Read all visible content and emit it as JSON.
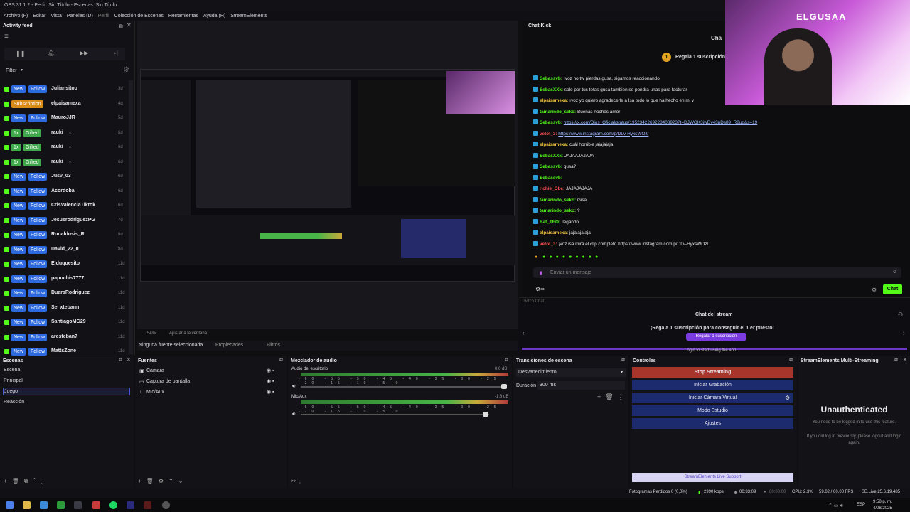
{
  "window": {
    "title": "OBS 31.1.2 - Perfil: Sin Título - Escenas: Sin Título"
  },
  "menu": [
    "Archivo (F)",
    "Editar",
    "Vista",
    "Paneles (D)",
    "Perfil",
    "Colección de Escenas",
    "Herramientas",
    "Ayuda (H)",
    "StreamElements"
  ],
  "activity": {
    "title": "Activity feed",
    "filter_label": "Filter",
    "rows": [
      {
        "badge": "New",
        "action": "Follow",
        "user": "Juliansitou",
        "age": "3d",
        "kind": "new"
      },
      {
        "badge": "Subscription",
        "action": "",
        "user": "elpaisamexa",
        "age": "4d",
        "kind": "sub"
      },
      {
        "badge": "New",
        "action": "Follow",
        "user": "MauroJJR",
        "age": "5d",
        "kind": "new"
      },
      {
        "badge": "1x",
        "action": "Gifted",
        "user": "rauki",
        "age": "6d",
        "kind": "gift"
      },
      {
        "badge": "1x",
        "action": "Gifted",
        "user": "rauki",
        "age": "6d",
        "kind": "gift"
      },
      {
        "badge": "1x",
        "action": "Gifted",
        "user": "rauki",
        "age": "6d",
        "kind": "gift"
      },
      {
        "badge": "New",
        "action": "Follow",
        "user": "Jusv_03",
        "age": "6d",
        "kind": "new"
      },
      {
        "badge": "New",
        "action": "Follow",
        "user": "Acordoba",
        "age": "6d",
        "kind": "new"
      },
      {
        "badge": "New",
        "action": "Follow",
        "user": "CrisValenciaTiktok",
        "age": "6d",
        "kind": "new"
      },
      {
        "badge": "New",
        "action": "Follow",
        "user": "JesusrodriguezPG",
        "age": "7d",
        "kind": "new"
      },
      {
        "badge": "New",
        "action": "Follow",
        "user": "Ronaldosis_R",
        "age": "8d",
        "kind": "new"
      },
      {
        "badge": "New",
        "action": "Follow",
        "user": "David_22_0",
        "age": "8d",
        "kind": "new"
      },
      {
        "badge": "New",
        "action": "Follow",
        "user": "Elduquesito",
        "age": "11d",
        "kind": "new"
      },
      {
        "badge": "New",
        "action": "Follow",
        "user": "papuchis7777",
        "age": "11d",
        "kind": "new"
      },
      {
        "badge": "New",
        "action": "Follow",
        "user": "DuarsRodriguez",
        "age": "11d",
        "kind": "new"
      },
      {
        "badge": "New",
        "action": "Follow",
        "user": "Se_xtebann",
        "age": "11d",
        "kind": "new"
      },
      {
        "badge": "New",
        "action": "Follow",
        "user": "SantiagoMG29",
        "age": "11d",
        "kind": "new"
      },
      {
        "badge": "New",
        "action": "Follow",
        "user": "aresteban7",
        "age": "11d",
        "kind": "new"
      },
      {
        "badge": "New",
        "action": "Follow",
        "user": "MattsZone",
        "age": "11d",
        "kind": "new"
      }
    ]
  },
  "preview": {
    "zoom": "54%",
    "fit_label": "Ajustar a la ventana",
    "no_source": "Ninguna fuente seleccionada",
    "properties": "Propiedades",
    "filters": "Filtros"
  },
  "chat_kick": {
    "title": "Chat Kick",
    "header_right": "Cha",
    "gift_banner": "Regala 1 suscripción",
    "lines": [
      {
        "user": "Sebassvb:",
        "text": "¡voz no tw pierdas gusa, sigamos reaccionando",
        "style": "n"
      },
      {
        "user": "SebasXXk:",
        "text": "solo por tus tetas gusa tambien se pondra unas para facturar",
        "style": "n"
      },
      {
        "user": "elpaisamexa:",
        "text": "¡voz yo quiero agradecerle a Isa todo lo que ha hecho en mi v",
        "style": "n3"
      },
      {
        "user": "tamarindo_seko:",
        "text": "Buenas noches amor",
        "style": "n"
      },
      {
        "user": "Sebassvb:",
        "text": "https://x.com/Dios_Oficial/status/1952342269228408923?t=DJWOK3jwDy43pDs89_R8ug&s=19",
        "style": "n",
        "link": true
      },
      {
        "user": "vetot_3:",
        "text": "https://www.instagram.com/p/DLv-HyxsWOz/",
        "style": "n2",
        "link": true
      },
      {
        "user": "elpaisamexa:",
        "text": "cuál horrible jajajajaja",
        "style": "n3"
      },
      {
        "user": "SebasXXk:",
        "text": "JAJAAJAJAJA",
        "style": "n"
      },
      {
        "user": "Sebassvb:",
        "text": "gusa?",
        "style": "n"
      },
      {
        "user": "Sebassvb:",
        "text": "",
        "style": "n"
      },
      {
        "user": "richie_Obc:",
        "text": "JAJAJAJAJA",
        "style": "n2"
      },
      {
        "user": "tamarindo_seko:",
        "text": "Gisa",
        "style": "n"
      },
      {
        "user": "tamarindo_seko:",
        "text": "?",
        "style": "n"
      },
      {
        "user": "Bat_TEO:",
        "text": "llegando",
        "style": "n"
      },
      {
        "user": "elpaisamexa:",
        "text": "jajajajajaja",
        "style": "n3"
      },
      {
        "user": "vetot_3:",
        "text": "¡voz isa mira el clip completo https://www.instagram.com/p/DLv-HyxsWOz/",
        "style": "n2"
      }
    ],
    "input_placeholder": "Enviar un mensaje",
    "send_label": "Chat"
  },
  "webcam": {
    "overlay_name": "ELGUSAA"
  },
  "twitch": {
    "small_title": "Twitch Chat",
    "title": "Chat del stream",
    "promo": "¡Regala 1 suscripción para conseguir el 1.er puesto!",
    "promo_button": "Regalar 1 suscripción",
    "login_text": "Login to start using the app."
  },
  "scenes": {
    "title": "Escenas",
    "items": [
      "Escena",
      "Principal",
      "Juego",
      "Reacción"
    ],
    "selected": 2
  },
  "sources": {
    "title": "Fuentes",
    "items": [
      "Cámara",
      "Captura de pantalla",
      "Mic/Aux"
    ]
  },
  "mixer": {
    "title": "Mezclador de audio",
    "channels": [
      {
        "name": "Audio del escritorio",
        "db": "0.0 dB",
        "level": 0.72
      },
      {
        "name": "Mic/Aux",
        "db": "-1.8 dB",
        "level": 0.68
      }
    ],
    "ticks": "-60 -55 -50 -45 -40 -35 -30 -25 -20 -15 -10 -5 0"
  },
  "transitions": {
    "title": "Transiciones de escena",
    "current": "Desvanecimiento",
    "duration_label": "Duración",
    "duration_value": "300 ms"
  },
  "controls": {
    "title": "Controles",
    "stop_streaming": "Stop Streaming",
    "recording": "Iniciar Grabación",
    "virtual_cam": "Iniciar Cámara Virtual",
    "studio": "Modo Estudio",
    "settings": "Ajustes"
  },
  "streamelements": {
    "title": "StreamElements Multi-Streaming",
    "heading": "Unauthenticated",
    "text1": "You need to be logged in to use this feature.",
    "text2": "If you did log in previously, please logout and login again.",
    "support": "StreamElements Live Support"
  },
  "status": {
    "dropped": "Fotogramas Perdidos 0 (0,0%)",
    "bitrate": "2990 kbps",
    "live_time": "00:33:09",
    "rec_time": "00:00:00",
    "cpu": "CPU: 2.3%",
    "fps": "59.02 / 60.00 FPS",
    "version": "SE.Live 25.6.19.485"
  },
  "taskbar": {
    "lang": "ESP",
    "time": "9:58 p. m.",
    "date": "4/08/2025"
  },
  "colors": {
    "kick_green": "#53fc18",
    "obs_blue": "#1c2a6e",
    "stop_red": "#a8352b",
    "purple": "#7a3ce0"
  }
}
